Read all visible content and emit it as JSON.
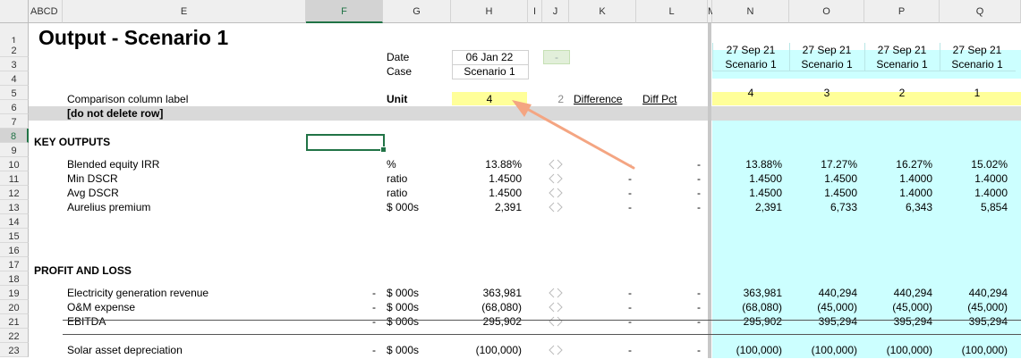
{
  "columns": [
    {
      "label": "ABCD"
    },
    {
      "label": "E"
    },
    {
      "label": "F"
    },
    {
      "label": "G"
    },
    {
      "label": "H"
    },
    {
      "label": "I"
    },
    {
      "label": "J"
    },
    {
      "label": "K"
    },
    {
      "label": "L"
    },
    {
      "label": "M"
    },
    {
      "label": "N"
    },
    {
      "label": "O"
    },
    {
      "label": "P"
    },
    {
      "label": "Q"
    }
  ],
  "rows": [
    "1",
    "2",
    "3",
    "4",
    "5",
    "6",
    "7",
    "8",
    "9",
    "10",
    "11",
    "12",
    "13",
    "14",
    "15",
    "16",
    "17",
    "18",
    "19",
    "20",
    "21",
    "22",
    "23"
  ],
  "title": "Output - Scenario 1",
  "header": {
    "date_label": "Date",
    "case_label": "Case",
    "date_value": "06 Jan 22",
    "case_value": "Scenario 1",
    "j2_value": "-",
    "unit_label": "Unit",
    "unit_value": "4",
    "i5_value": "2",
    "difference_label": "Difference",
    "diff_pct_label": "Diff Pct",
    "comparison_label": "Comparison column label",
    "do_not_delete": "[do not delete row]"
  },
  "comparison_columns": [
    {
      "date": "27 Sep 21",
      "case": "Scenario 1",
      "unit": "4"
    },
    {
      "date": "27 Sep 21",
      "case": "Scenario 1",
      "unit": "3"
    },
    {
      "date": "27 Sep 21",
      "case": "Scenario 1",
      "unit": "2"
    },
    {
      "date": "27 Sep 21",
      "case": "Scenario 1",
      "unit": "1"
    }
  ],
  "sections": {
    "key_outputs": "KEY OUTPUTS",
    "profit_and_loss": "PROFIT AND LOSS"
  },
  "key_outputs": [
    {
      "label": "Blended equity IRR",
      "unit": "%",
      "value": "13.88%",
      "diff": "-",
      "pct": "-",
      "cmp": [
        "13.88%",
        "17.27%",
        "16.27%",
        "15.02%"
      ]
    },
    {
      "label": "Min DSCR",
      "unit": "ratio",
      "value": "1.4500",
      "diff": "-",
      "pct": "-",
      "cmp": [
        "1.4500",
        "1.4500",
        "1.4000",
        "1.4000"
      ]
    },
    {
      "label": "Avg DSCR",
      "unit": "ratio",
      "value": "1.4500",
      "diff": "-",
      "pct": "-",
      "cmp": [
        "1.4500",
        "1.4500",
        "1.4000",
        "1.4000"
      ]
    },
    {
      "label": "Aurelius premium",
      "unit": "$ 000s",
      "value": "2,391",
      "diff": "-",
      "pct": "-",
      "cmp": [
        "2,391",
        "6,733",
        "6,343",
        "5,854"
      ]
    }
  ],
  "pnl": [
    {
      "label": "Electricity generation revenue",
      "f": "-",
      "unit": "$ 000s",
      "value": "363,981",
      "diff": "-",
      "pct": "-",
      "cmp": [
        "363,981",
        "440,294",
        "440,294",
        "440,294"
      ]
    },
    {
      "label": "O&M expense",
      "f": "-",
      "unit": "$ 000s",
      "value": "(68,080)",
      "diff": "-",
      "pct": "-",
      "cmp": [
        "(68,080)",
        "(45,000)",
        "(45,000)",
        "(45,000)"
      ]
    },
    {
      "label": "EBITDA",
      "f": "-",
      "unit": "$ 000s",
      "value": "295,902",
      "diff": "-",
      "pct": "-",
      "cmp": [
        "295,902",
        "395,294",
        "395,294",
        "395,294"
      ]
    },
    {
      "label": "Solar asset depreciation",
      "f": "-",
      "unit": "$ 000s",
      "value": "(100,000)",
      "diff": "-",
      "pct": "-",
      "cmp": [
        "(100,000)",
        "(100,000)",
        "(100,000)",
        "(100,000)"
      ]
    }
  ],
  "colors": {
    "accent_arrow": "#f4a582",
    "cyan_fill": "#ccffff",
    "yellow_fill": "#ffff99",
    "grid": "#d9d9d9"
  }
}
